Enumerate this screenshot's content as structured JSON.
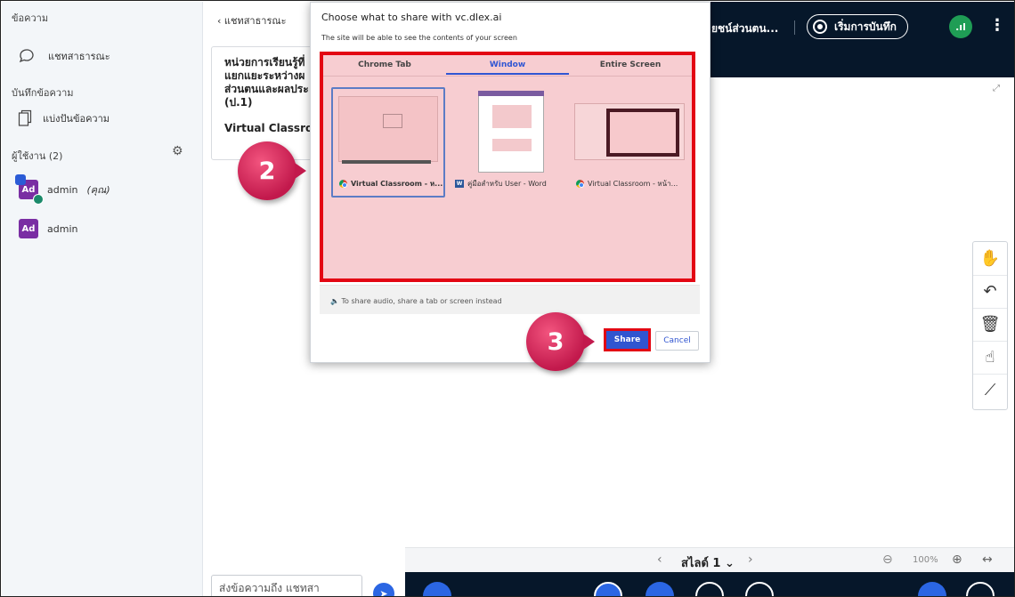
{
  "sidebar": {
    "messages_title": "ข้อความ",
    "public_chat": "แชทสาธารณะ",
    "notes_title": "บันทึกข้อความ",
    "shared_notes": "แบ่งปันข้อความ",
    "users_title": "ผู้ใช้งาน (2)",
    "users": [
      {
        "initials": "Ad",
        "name": "admin",
        "suffix": "(คุณ)"
      },
      {
        "initials": "Ad",
        "name": "admin",
        "suffix": ""
      }
    ]
  },
  "chat": {
    "back_label": "‹  แชทสาธารณะ",
    "welcome_lines": [
      "หน่วยการเรียนรู้ที่",
      "แยกแยะระหว่างผ",
      "ส่วนตนและผลประ",
      "(ป.1)"
    ],
    "welcome_footer": "Virtual Classroom",
    "input_placeholder": "ส่งข้อความถึง แชทสา"
  },
  "topbar": {
    "title": "ยชน์ส่วนตน...",
    "record_label": "เริ่มการบันทึก"
  },
  "slides": {
    "label": "สไลด์ 1 ⌄",
    "zoom": "100%"
  },
  "dialog": {
    "title": "Choose what to share with vc.dlex.ai",
    "subtitle": "The site will be able to see the contents of your screen",
    "tabs": [
      "Chrome Tab",
      "Window",
      "Entire Screen"
    ],
    "active_tab": "Window",
    "windows": [
      {
        "label": "Virtual Classroom - ห...",
        "icon": "chrome-icon"
      },
      {
        "label": "คู่มือสำหรับ User - Word",
        "icon": "word-icon"
      },
      {
        "label": "Virtual Classroom - หน้า...",
        "icon": "chrome-icon"
      }
    ],
    "audio_note": "To share audio, share a tab or screen instead",
    "share_label": "Share",
    "cancel_label": "Cancel"
  },
  "callouts": {
    "step2": "2",
    "step3": "3"
  },
  "colors": {
    "highlight": "#e30613",
    "accent": "#3055d0",
    "dark_bar": "#06172a",
    "badge": "#d6245a"
  }
}
